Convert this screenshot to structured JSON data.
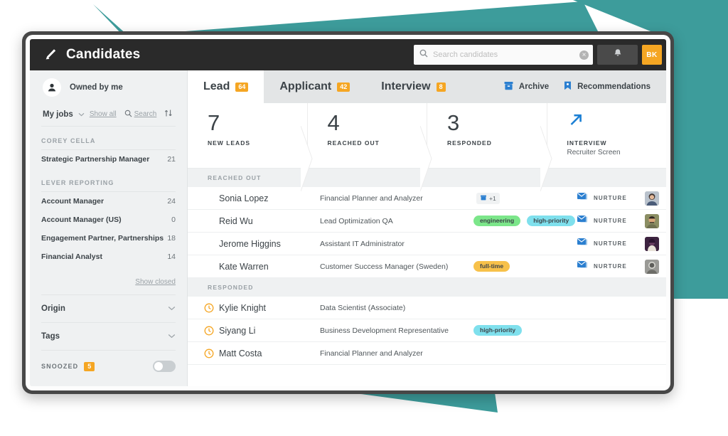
{
  "window": {
    "app_title": "Candidates",
    "logo_icon": "pencil-icon"
  },
  "topbar": {
    "search_placeholder": "Search candidates",
    "search_value": "",
    "search_icon": "search-icon",
    "clear_icon": "clear-circle-icon",
    "clear_glyph": "×",
    "notifications_icon": "bell-icon",
    "avatar_initials": "BK"
  },
  "sidebar": {
    "owned_by_label": "Owned by me",
    "owner_icon": "person-icon",
    "my_jobs_label": "My jobs",
    "show_all_label": "Show all",
    "search_label": "Search",
    "search_icon": "search-icon",
    "sort_icon": "sort-arrows-icon",
    "chevron_icon": "chevron-down-icon",
    "groups": [
      {
        "heading": "COREY CELLA",
        "jobs": [
          {
            "name": "Strategic Partnership Manager",
            "count": "21"
          }
        ]
      },
      {
        "heading": "LEVER REPORTING",
        "jobs": [
          {
            "name": "Account Manager",
            "count": "24"
          },
          {
            "name": "Account Manager (US)",
            "count": "0"
          },
          {
            "name": "Engagement Partner, Partnerships",
            "count": "18"
          },
          {
            "name": "Financial Analyst",
            "count": "14"
          }
        ]
      }
    ],
    "show_closed_label": "Show closed",
    "filters": [
      {
        "label": "Origin",
        "icon": "chevron-down-icon"
      },
      {
        "label": "Tags",
        "icon": "chevron-down-icon"
      }
    ],
    "snoozed_label": "SNOOZED",
    "snoozed_count": "5",
    "snoozed_toggle_on": false
  },
  "tabs": [
    {
      "label": "Lead",
      "count": "64",
      "active": true
    },
    {
      "label": "Applicant",
      "count": "42",
      "active": false
    },
    {
      "label": "Interview",
      "count": "8",
      "active": false
    }
  ],
  "tab_links": [
    {
      "label": "Archive",
      "icon": "archive-box-icon"
    },
    {
      "label": "Recommendations",
      "icon": "bookmark-icon"
    }
  ],
  "pipeline": [
    {
      "number": "7",
      "label": "NEW LEADS",
      "sub": ""
    },
    {
      "number": "4",
      "label": "REACHED OUT",
      "sub": ""
    },
    {
      "number": "3",
      "label": "RESPONDED",
      "sub": ""
    },
    {
      "number": "",
      "label": "INTERVIEW",
      "sub": "Recruiter Screen",
      "icon": "arrow-up-right-icon"
    }
  ],
  "sections": [
    {
      "heading": "REACHED OUT",
      "rows": [
        {
          "name": "Sonia Lopez",
          "title": "Financial Planner and Analyzer",
          "mini_badge": {
            "icon": "archive-box-icon",
            "text": "+1"
          },
          "tags": [],
          "nurture_label": "NURTURE",
          "nurture_icon": "envelope-stack-icon",
          "avatar": "photo-avatar-1"
        },
        {
          "name": "Reid Wu",
          "title": "Lead Optimization QA",
          "tags": [
            {
              "label": "engineering",
              "color": "#7ce68a"
            },
            {
              "label": "high-priority",
              "color": "#7fe0ed"
            }
          ],
          "nurture_label": "NURTURE",
          "nurture_icon": "envelope-stack-icon",
          "avatar": "photo-avatar-2"
        },
        {
          "name": "Jerome Higgins",
          "title": "Assistant IT Administrator",
          "tags": [],
          "nurture_label": "NURTURE",
          "nurture_icon": "envelope-stack-icon",
          "avatar": "photo-avatar-3"
        },
        {
          "name": "Kate Warren",
          "title": "Customer Success Manager (Sweden)",
          "tags": [
            {
              "label": "full-time",
              "color": "#f7c14a"
            }
          ],
          "nurture_label": "NURTURE",
          "nurture_icon": "envelope-stack-icon",
          "avatar": "photo-avatar-4"
        }
      ]
    },
    {
      "heading": "RESPONDED",
      "rows": [
        {
          "icon": "clock-icon",
          "name": "Kylie Knight",
          "title": "Data Scientist (Associate)",
          "tags": [],
          "nurture_label": "",
          "avatar": ""
        },
        {
          "icon": "clock-icon",
          "name": "Siyang Li",
          "title": "Business Development Representative",
          "tags": [
            {
              "label": "high-priority",
              "color": "#7fe0ed"
            }
          ],
          "nurture_label": "",
          "avatar": ""
        },
        {
          "icon": "clock-icon",
          "name": "Matt Costa",
          "title": "Financial Planner and Analyzer",
          "tags": [],
          "nurture_label": "",
          "avatar": ""
        }
      ]
    }
  ],
  "colors": {
    "accent_orange": "#f5a623",
    "teal_background": "#3d9c9b",
    "topbar_dark": "#2a2a2a",
    "sidebar_bg": "#eff1f2",
    "tab_bar_bg": "#e3e5e6",
    "link_blue": "#1b7fd4"
  }
}
